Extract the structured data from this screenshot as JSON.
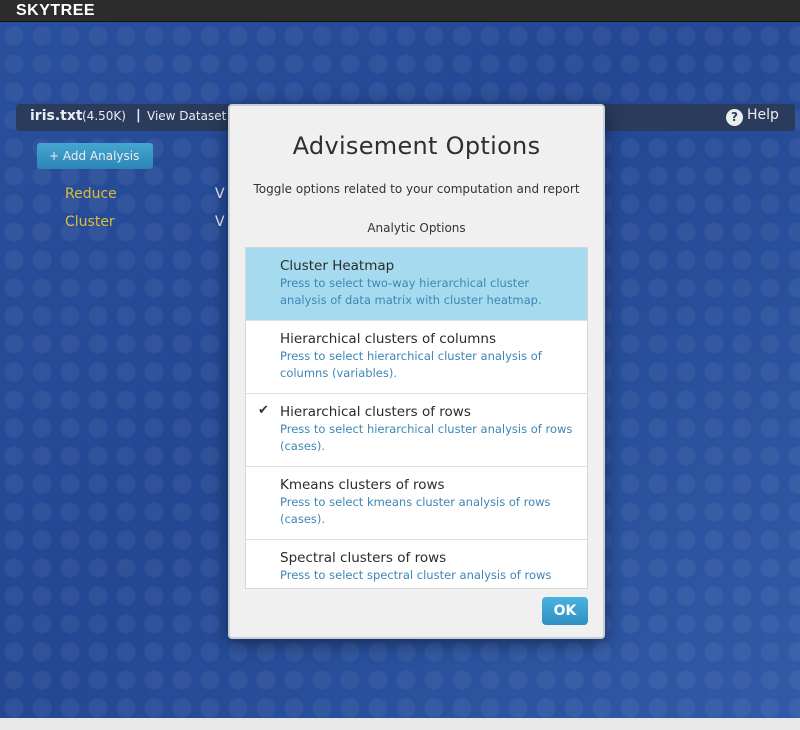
{
  "app": {
    "title": "SKYTREE"
  },
  "dataset": {
    "name": "iris.txt",
    "size": "(4.50K)",
    "separator": "|",
    "view_label": "View Dataset"
  },
  "help": {
    "icon": "?",
    "label": "Help"
  },
  "add_analysis": {
    "label": "+ Add Analysis"
  },
  "analyses": [
    {
      "label": "Reduce",
      "value": "V"
    },
    {
      "label": "Cluster",
      "value": "V"
    }
  ],
  "modal": {
    "title": "Advisement Options",
    "subtitle": "Toggle options related to your computation and report",
    "section": "Analytic Options",
    "ok_label": "OK",
    "options": [
      {
        "title": "Cluster Heatmap",
        "desc": "Press to select two-way hierarchical cluster analysis of data matrix with cluster heatmap.",
        "checked": "",
        "state": "highlighted"
      },
      {
        "title": "Hierarchical clusters of columns",
        "desc": "Press to select hierarchical cluster analysis of columns (variables).",
        "checked": ""
      },
      {
        "title": "Hierarchical clusters of rows",
        "desc": "Press to select hierarchical cluster analysis of rows (cases).",
        "checked": "✔"
      },
      {
        "title": "Kmeans clusters of rows",
        "desc": "Press to select kmeans cluster analysis of rows (cases).",
        "checked": ""
      },
      {
        "title": "Spectral clusters of rows",
        "desc": "Press to select spectral cluster analysis of rows",
        "checked": ""
      }
    ]
  },
  "colors": {
    "accent": "#3a9fd0",
    "selected": "#a6dbef",
    "analysis_label": "#f0c93a",
    "link": "#3d86b5"
  }
}
